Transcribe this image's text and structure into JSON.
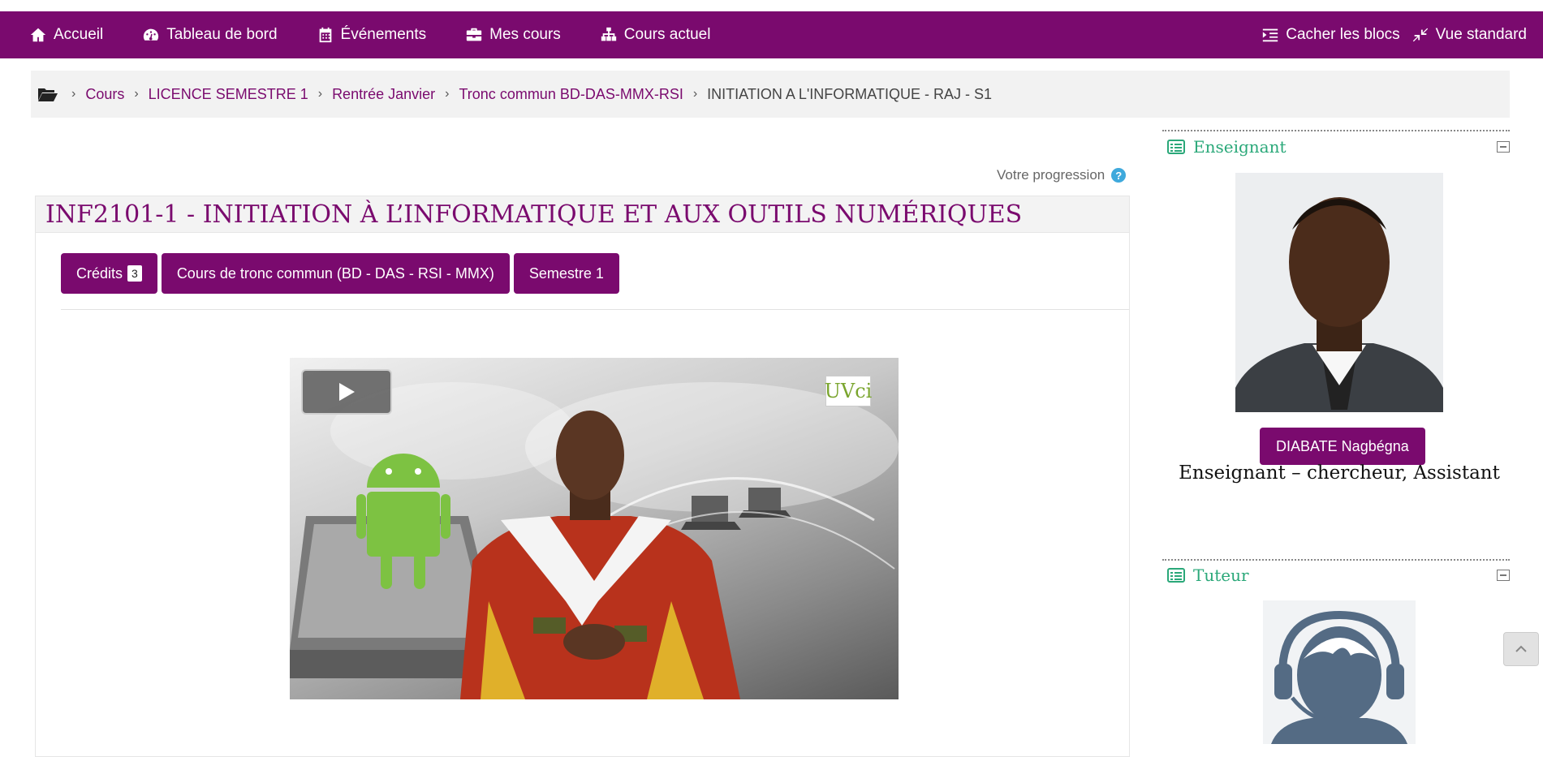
{
  "navbar": {
    "left_items": [
      {
        "label": "Accueil",
        "icon": "home-icon"
      },
      {
        "label": "Tableau de bord",
        "icon": "dashboard-icon"
      },
      {
        "label": "Événements",
        "icon": "calendar-icon"
      },
      {
        "label": "Mes cours",
        "icon": "briefcase-icon"
      },
      {
        "label": "Cours actuel",
        "icon": "sitemap-icon"
      }
    ],
    "right_items": [
      {
        "label": "Cacher les blocs",
        "icon": "indent-icon"
      },
      {
        "label": "Vue standard",
        "icon": "compress-icon"
      }
    ]
  },
  "breadcrumb": {
    "links": [
      "Cours",
      "LICENCE SEMESTRE 1",
      "Rentrée Janvier",
      "Tronc commun BD-DAS-MMX-RSI"
    ],
    "current": "INITIATION A L'INFORMATIQUE - RAJ - S1"
  },
  "progress": {
    "label": "Votre progression",
    "help": "?"
  },
  "course": {
    "title": "INF2101-1 - INITIATION À L’INFORMATIQUE ET AUX OUTILS NUMÉRIQUES",
    "credits_label": "Crédits",
    "credits_value": "3",
    "track_label": "Cours de tronc commun (BD - DAS - RSI - MMX)",
    "semester_label": "Semestre 1",
    "video_logo": "UVci"
  },
  "teacher_block": {
    "title": "Enseignant",
    "name": "DIABATE Nagbégna",
    "role": "Enseignant – chercheur, Assistant"
  },
  "tutor_block": {
    "title": "Tuteur"
  },
  "colors": {
    "brand": "#7a0a6e",
    "block_title": "#2aa879",
    "help": "#3fa9dc"
  }
}
